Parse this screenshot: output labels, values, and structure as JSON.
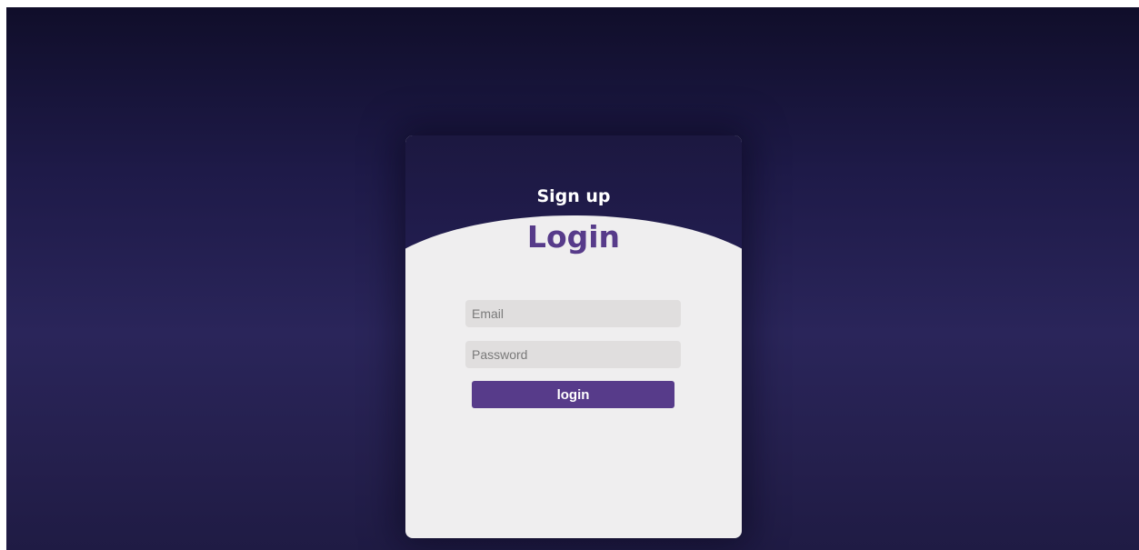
{
  "signup": {
    "title": "Sign up"
  },
  "login": {
    "title": "Login",
    "email_placeholder": "Email",
    "password_placeholder": "Password",
    "button_label": "login"
  },
  "colors": {
    "accent": "#573b8a",
    "background_top": "#100e2a",
    "background_mid": "#2a255a",
    "card_surface": "#efeeef",
    "input_fill": "#e0dede"
  }
}
